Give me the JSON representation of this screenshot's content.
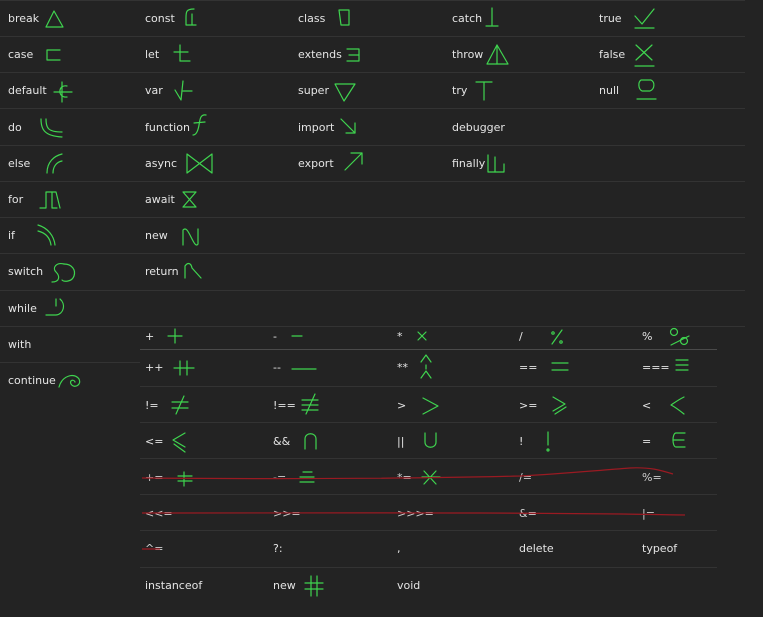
{
  "keywords": {
    "break": "break",
    "const": "const",
    "class": "class",
    "catch": "catch",
    "true": "true",
    "case": "case",
    "let": "let",
    "extends": "extends",
    "throw": "throw",
    "false": "false",
    "default": "default",
    "var": "var",
    "super": "super",
    "try": "try",
    "null": "null",
    "do": "do",
    "function": "function",
    "import": "import",
    "debugger": "debugger",
    "else": "else",
    "async": "async",
    "export": "export",
    "finally": "finally",
    "for": "for",
    "await": "await",
    "if": "if",
    "new": "new",
    "switch": "switch",
    "return": "return",
    "while": "while",
    "with": "with",
    "continue": "continue"
  },
  "operators": {
    "plus": "+",
    "minus": "-",
    "mul": "*",
    "div": "/",
    "mod": "%",
    "inc": "++",
    "dec": "--",
    "exp": "**",
    "eq": "==",
    "seq": "===",
    "neq": "!=",
    "sneq": "!==",
    "gt": ">",
    "gte": ">=",
    "lt": "<",
    "lte": "<=",
    "and": "&&",
    "or": "||",
    "not": "!",
    "assign": "=",
    "plus_eq": "+=",
    "minus_eq": "-=",
    "mul_eq": "*=",
    "div_eq": "/=",
    "mod_eq": "%=",
    "shl_eq": "<<=",
    "shr_eq": ">>=",
    "ushr_eq": ">>>=",
    "and_eq": "&=",
    "or_eq": "|=",
    "xor_eq": "^=",
    "ternary": "?:",
    "comma": ",",
    "delete": "delete",
    "typeof": "typeof",
    "instanceof": "instanceof",
    "new": "new",
    "void": "void"
  },
  "colors": {
    "background": "#232323",
    "glyph": "#3fd44f",
    "strike": "#9a1a22",
    "text": "#e4e4e4"
  }
}
